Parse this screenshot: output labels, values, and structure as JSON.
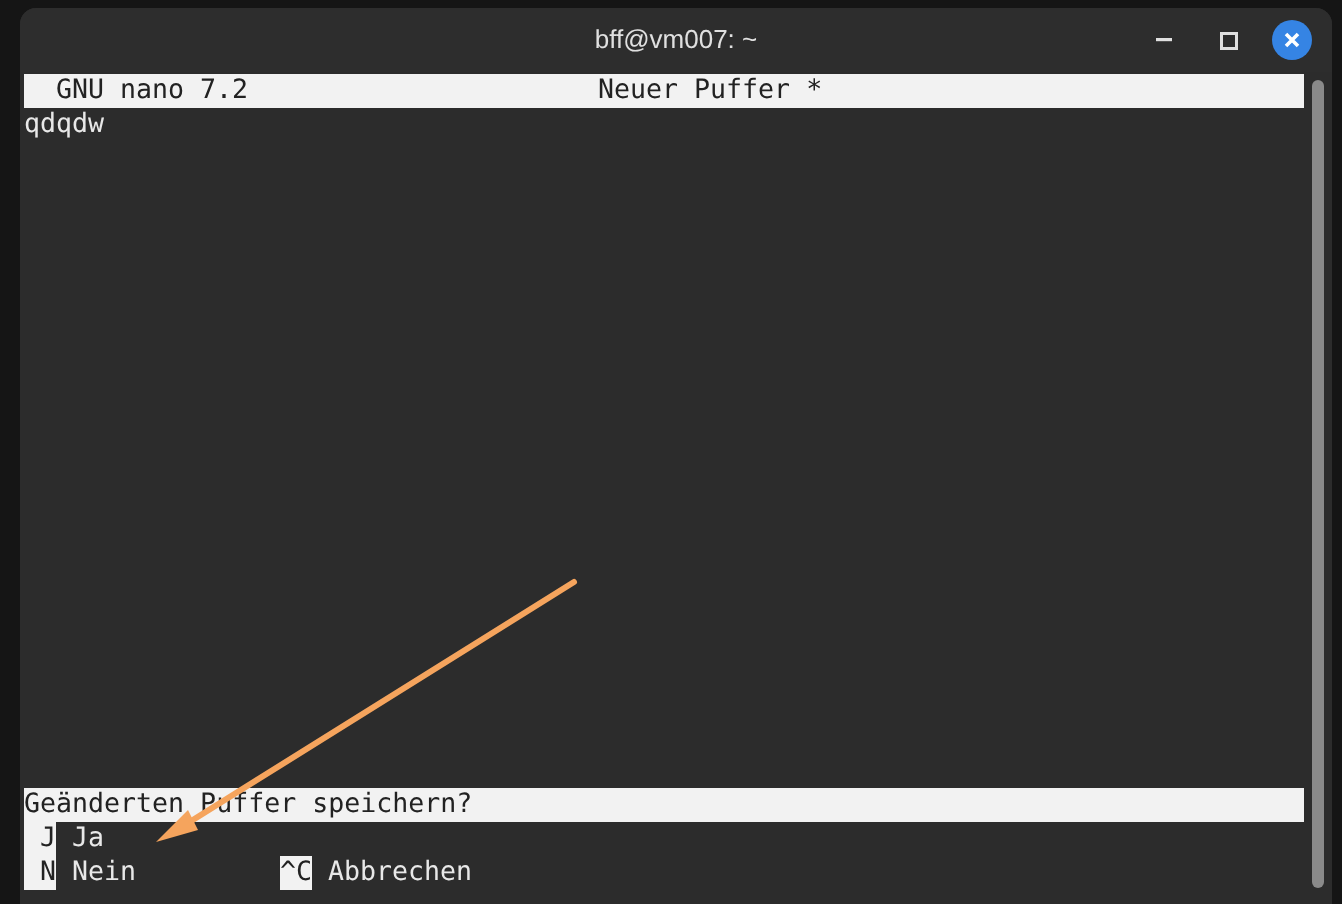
{
  "window": {
    "title": "bff@vm007: ~"
  },
  "editor": {
    "program": "GNU nano 7.2",
    "buffer": "Neuer Puffer *",
    "lines": [
      "qdqdw"
    ]
  },
  "prompt": {
    "question": "Geänderten Puffer speichern?",
    "rows": [
      {
        "options": [
          {
            "key": "J",
            "label": "Ja"
          }
        ]
      },
      {
        "options": [
          {
            "key": "N",
            "label": "Nein"
          },
          {
            "key": "^C",
            "label": "Abbrechen"
          }
        ]
      }
    ]
  }
}
